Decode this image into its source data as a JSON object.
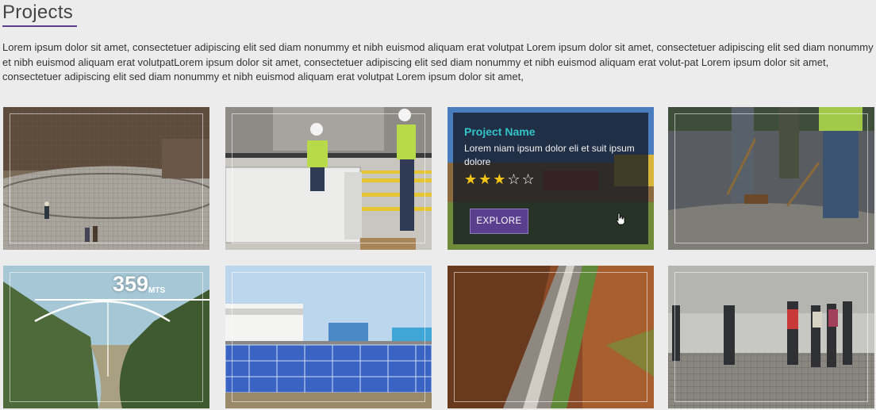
{
  "page": {
    "title": "Projects",
    "intro": "Lorem ipsum dolor sit amet, consectetuer adipiscing elit sed diam nonummy et nibh euismod aliquam erat volutpat Lorem ipsum dolor sit amet, consectetuer adipiscing elit sed diam nonummy et nibh euismod aliquam erat volutpatLorem ipsum dolor sit amet, consectetuer adipiscing elit sed diam nonummy et nibh euismod aliquam erat volut-pat Lorem ipsum dolor sit amet, consectetuer adipiscing elit sed diam nonummy et nibh euismod aliquam erat volutpat Lorem ipsum dolor sit amet,"
  },
  "hover_card": {
    "title": "Project Name",
    "description": "Lorem niam ipsum dolor eli et suit ipsum dolore",
    "rating": 3,
    "rating_max": 5,
    "stars": "★★★",
    "stars_empty": "☆☆",
    "button_label": "EXPLORE"
  },
  "bridge_tile": {
    "height_value": "359",
    "height_unit": "MTS"
  },
  "colors": {
    "accent": "#5b3f8f",
    "title_accent": "#33c3c9",
    "background": "#ececec",
    "star": "#f5c518"
  },
  "tiles": [
    {
      "icon": "rebar-foundation-image"
    },
    {
      "icon": "workers-container-image"
    },
    {
      "icon": "construction-site-image"
    },
    {
      "icon": "workers-shoveling-image"
    },
    {
      "icon": "bridge-valley-image"
    },
    {
      "icon": "solar-panels-image"
    },
    {
      "icon": "canal-channel-image"
    },
    {
      "icon": "workers-rebar-grid-image"
    }
  ]
}
